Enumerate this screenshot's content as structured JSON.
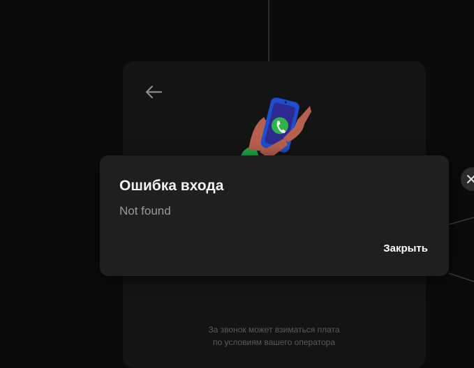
{
  "dialog": {
    "title": "Ошибка входа",
    "message": "Not found",
    "close_label": "Закрыть"
  },
  "footnote": {
    "line1": "За звонок может взиматься плата",
    "line2": "по условиям вашего оператора"
  },
  "icons": {
    "back": "arrow-left-icon",
    "side_close": "close-icon",
    "illustration": "phone-call-illustration"
  },
  "colors": {
    "background": "#0b0b0b",
    "card": "#141414",
    "dialog": "#1e1f21",
    "accent_green": "#2eb54a",
    "phone_blue": "#1f4fd1"
  }
}
